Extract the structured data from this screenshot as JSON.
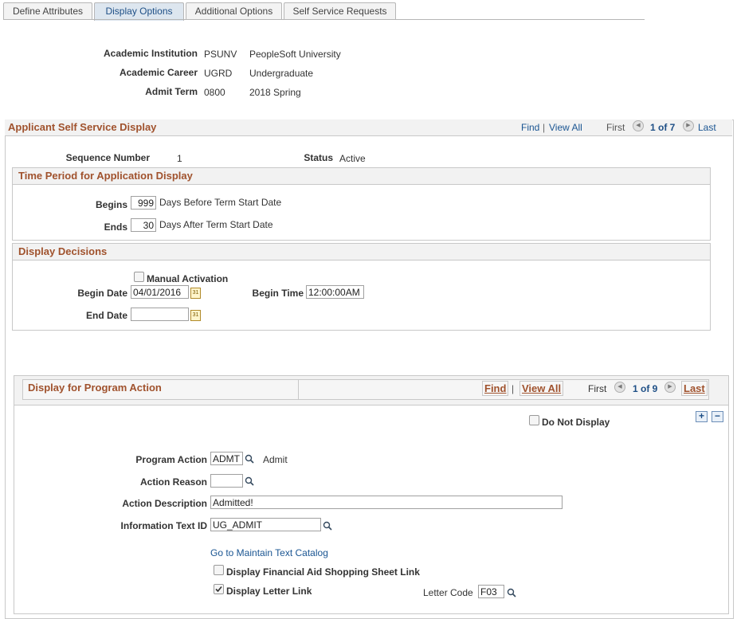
{
  "tabs": [
    {
      "label": "Define Attributes"
    },
    {
      "label": "Display Options"
    },
    {
      "label": "Additional Options"
    },
    {
      "label": "Self Service Requests"
    }
  ],
  "header": {
    "institution_label": "Academic Institution",
    "institution_code": "PSUNV",
    "institution_desc": "PeopleSoft University",
    "career_label": "Academic Career",
    "career_code": "UGRD",
    "career_desc": "Undergraduate",
    "term_label": "Admit Term",
    "term_code": "0800",
    "term_desc": "2018 Spring"
  },
  "display_section": {
    "title": "Applicant Self Service Display",
    "find": "Find",
    "sep": "|",
    "view_all": "View All",
    "first": "First",
    "count": "1 of 7",
    "last": "Last",
    "seq_label": "Sequence Number",
    "seq_value": "1",
    "status_label": "Status",
    "status_value": "Active"
  },
  "time_period": {
    "title": "Time Period for Application Display",
    "begins_label": "Begins",
    "begins_value": "999",
    "begins_suffix": "Days Before Term Start Date",
    "ends_label": "Ends",
    "ends_value": "30",
    "ends_suffix": "Days After Term Start Date"
  },
  "decisions": {
    "title": "Display Decisions",
    "manual_label": "Manual Activation",
    "begin_date_label": "Begin Date",
    "begin_date_value": "04/01/2016",
    "begin_time_label": "Begin Time",
    "begin_time_value": "12:00:00AM",
    "end_date_label": "End Date",
    "end_date_value": ""
  },
  "program_action": {
    "title": "Display for Program Action",
    "find": "Find",
    "sep": "|",
    "view_all": "View All",
    "first": "First",
    "count": "1 of 9",
    "last": "Last",
    "do_not_display_label": "Do Not Display",
    "action_label": "Program Action",
    "action_value": "ADMT",
    "action_desc": "Admit",
    "reason_label": "Action Reason",
    "reason_value": "",
    "desc_label": "Action Description",
    "desc_value": "Admitted!",
    "info_label": "Information Text ID",
    "info_value": "UG_ADMIT",
    "catalog_link": "Go to Maintain Text Catalog",
    "fin_aid_label": "Display Financial Aid Shopping Sheet Link",
    "letter_link_label": "Display Letter Link",
    "letter_code_label": "Letter Code",
    "letter_code_value": "F03"
  }
}
